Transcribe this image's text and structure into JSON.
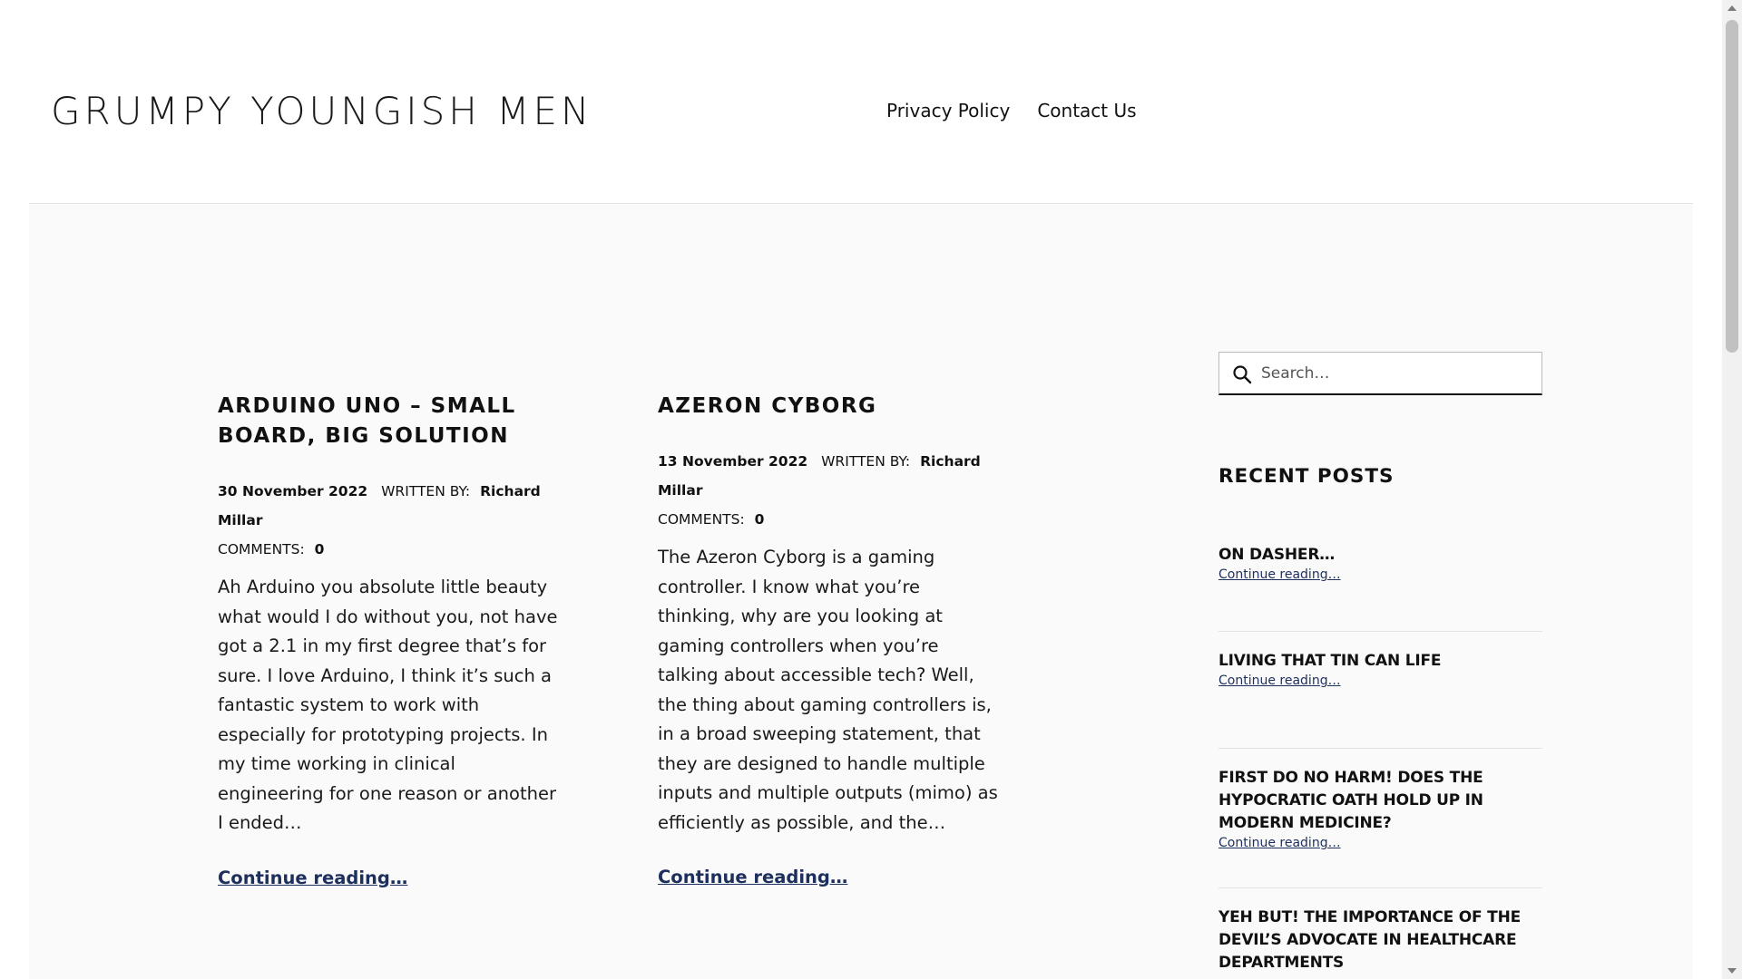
{
  "site": {
    "title": "GRUMPY YOUNGISH MEN"
  },
  "nav": {
    "items": [
      {
        "label": "Privacy Policy"
      },
      {
        "label": "Contact Us"
      }
    ]
  },
  "posts": [
    {
      "title": "ARDUINO UNO – SMALL BOARD, BIG SOLUTION",
      "date": "30 November 2022",
      "written_by_label": "WRITTEN BY:",
      "author": "Richard Millar",
      "comments_label": "COMMENTS:",
      "comments_count": "0",
      "excerpt": "Ah Arduino you absolute little beauty what would I do without you, not have got a 2.1 in my first degree that’s for sure. I love Arduino, I think it’s such a fantastic system to work with especially for prototyping projects. In my time working in clinical engineering for one reason or another I ended…",
      "more_label": "Continue reading…"
    },
    {
      "title": "AZERON CYBORG",
      "date": "13 November 2022",
      "written_by_label": "WRITTEN BY:",
      "author": "Richard Millar",
      "comments_label": "COMMENTS:",
      "comments_count": "0",
      "excerpt": "The Azeron Cyborg is a gaming controller. I know what you’re thinking, why are you looking at gaming controllers when you’re talking about accessible tech? Well, the thing about gaming controllers is, in a broad sweeping statement, that they are designed to handle multiple inputs and multiple outputs (mimo) as efficiently as possible, and the…",
      "more_label": "Continue reading…"
    }
  ],
  "sidebar": {
    "search": {
      "placeholder": "Search…",
      "icon": "search-icon"
    },
    "recent_posts_title": "RECENT POSTS",
    "recent_posts": [
      {
        "title": "ON DASHER…",
        "more_label": "Continue reading…"
      },
      {
        "title": "LIVING THAT TIN CAN LIFE",
        "more_label": "Continue reading…"
      },
      {
        "title": "FIRST DO NO HARM! DOES THE HYPOCRATIC OATH HOLD UP IN MODERN MEDICINE?",
        "more_label": "Continue reading…"
      },
      {
        "title": "YEH BUT! THE IMPORTANCE OF THE DEVIL’S ADVOCATE IN HEALTHCARE DEPARTMENTS",
        "more_label": ""
      }
    ]
  },
  "colors": {
    "link": "#1d2f5c",
    "content_background": "#fafafa",
    "text": "#111111"
  }
}
